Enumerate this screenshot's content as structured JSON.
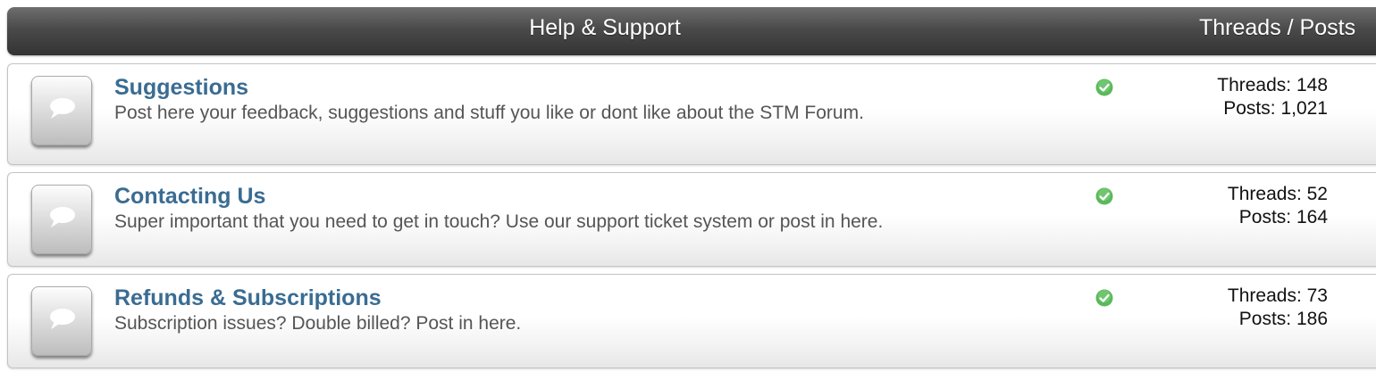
{
  "header": {
    "title": "Help & Support",
    "stats_label": "Threads / Posts"
  },
  "forums": [
    {
      "title": "Suggestions",
      "description": "Post here your feedback, suggestions and stuff you like or dont like about the STM Forum.",
      "threads": "Threads: 148",
      "posts": "Posts: 1,021",
      "icon": "speech-bubble-icon",
      "status_icon": "check-circle-icon"
    },
    {
      "title": "Contacting Us",
      "description": "Super important that you need to get in touch? Use our support ticket system or post in here.",
      "threads": "Threads: 52",
      "posts": "Posts: 164",
      "icon": "speech-bubble-icon",
      "status_icon": "check-circle-icon"
    },
    {
      "title": "Refunds & Subscriptions",
      "description": "Subscription issues? Double billed? Post in here.",
      "threads": "Threads: 73",
      "posts": "Posts: 186",
      "icon": "speech-bubble-icon",
      "status_icon": "check-circle-icon"
    }
  ],
  "colors": {
    "title_link": "#3a6c92",
    "status_green": "#5bb85b",
    "header_bg": "#4a4a4a"
  }
}
